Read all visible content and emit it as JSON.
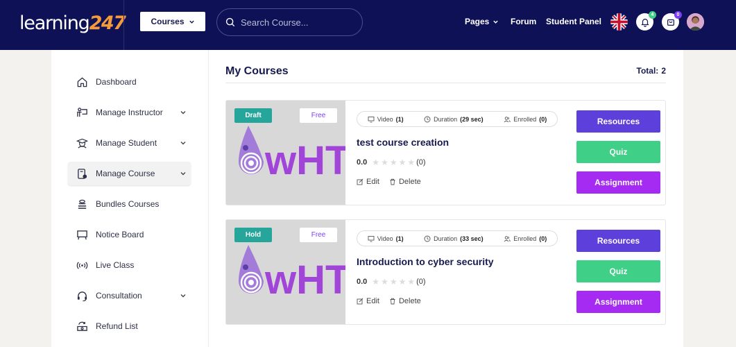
{
  "header": {
    "logo_text": "learning",
    "logo_number": "247",
    "courses_button": "Courses",
    "search_placeholder": "Search Course...",
    "nav": {
      "pages": "Pages",
      "forum": "Forum",
      "student_panel": "Student Panel"
    },
    "notification_count": "4",
    "cart_count": "0"
  },
  "sidebar": {
    "items": [
      {
        "label": "Dashboard",
        "icon": "home-icon",
        "has_chevron": false
      },
      {
        "label": "Manage Instructor",
        "icon": "instructor-icon",
        "has_chevron": true
      },
      {
        "label": "Manage Student",
        "icon": "student-icon",
        "has_chevron": true
      },
      {
        "label": "Manage Course",
        "icon": "course-icon",
        "has_chevron": true,
        "active": true
      },
      {
        "label": "Bundles Courses",
        "icon": "bundle-icon",
        "has_chevron": false
      },
      {
        "label": "Notice Board",
        "icon": "board-icon",
        "has_chevron": false
      },
      {
        "label": "Live Class",
        "icon": "broadcast-icon",
        "has_chevron": false
      },
      {
        "label": "Consultation",
        "icon": "headset-icon",
        "has_chevron": true
      },
      {
        "label": "Refund List",
        "icon": "refund-icon",
        "has_chevron": false
      }
    ]
  },
  "main": {
    "title": "My Courses",
    "total_label": "Total:",
    "total_value": "2",
    "courses": [
      {
        "status": "Draft",
        "price": "Free",
        "thumb_text": "wHTa",
        "video_label": "Video",
        "video_count": "(1)",
        "duration_label": "Duration",
        "duration_value": "(29 sec)",
        "enrolled_label": "Enrolled",
        "enrolled_value": "(0)",
        "title": "test course creation",
        "rating": "0.0",
        "rating_count": "(0)",
        "stars": 0,
        "edit": "Edit",
        "delete": "Delete",
        "resources": "Resources",
        "quiz": "Quiz",
        "assignment": "Assignment"
      },
      {
        "status": "Hold",
        "price": "Free",
        "thumb_text": "wHTa",
        "video_label": "Video",
        "video_count": "(1)",
        "duration_label": "Duration",
        "duration_value": "(33 sec)",
        "enrolled_label": "Enrolled",
        "enrolled_value": "(0)",
        "title": "Introduction to cyber security",
        "rating": "0.0",
        "rating_count": "(0)",
        "stars": 0,
        "edit": "Edit",
        "delete": "Delete",
        "resources": "Resources",
        "quiz": "Quiz",
        "assignment": "Assignment"
      }
    ]
  },
  "colors": {
    "header_bg": "#0f1156",
    "status_badge": "#26a69a",
    "resources_btn": "#5d3fdb",
    "quiz_btn": "#3fcf86",
    "assignment_btn": "#a62bf2",
    "notification_badge": "#3fcf86",
    "cart_badge": "#7b3ff2"
  }
}
